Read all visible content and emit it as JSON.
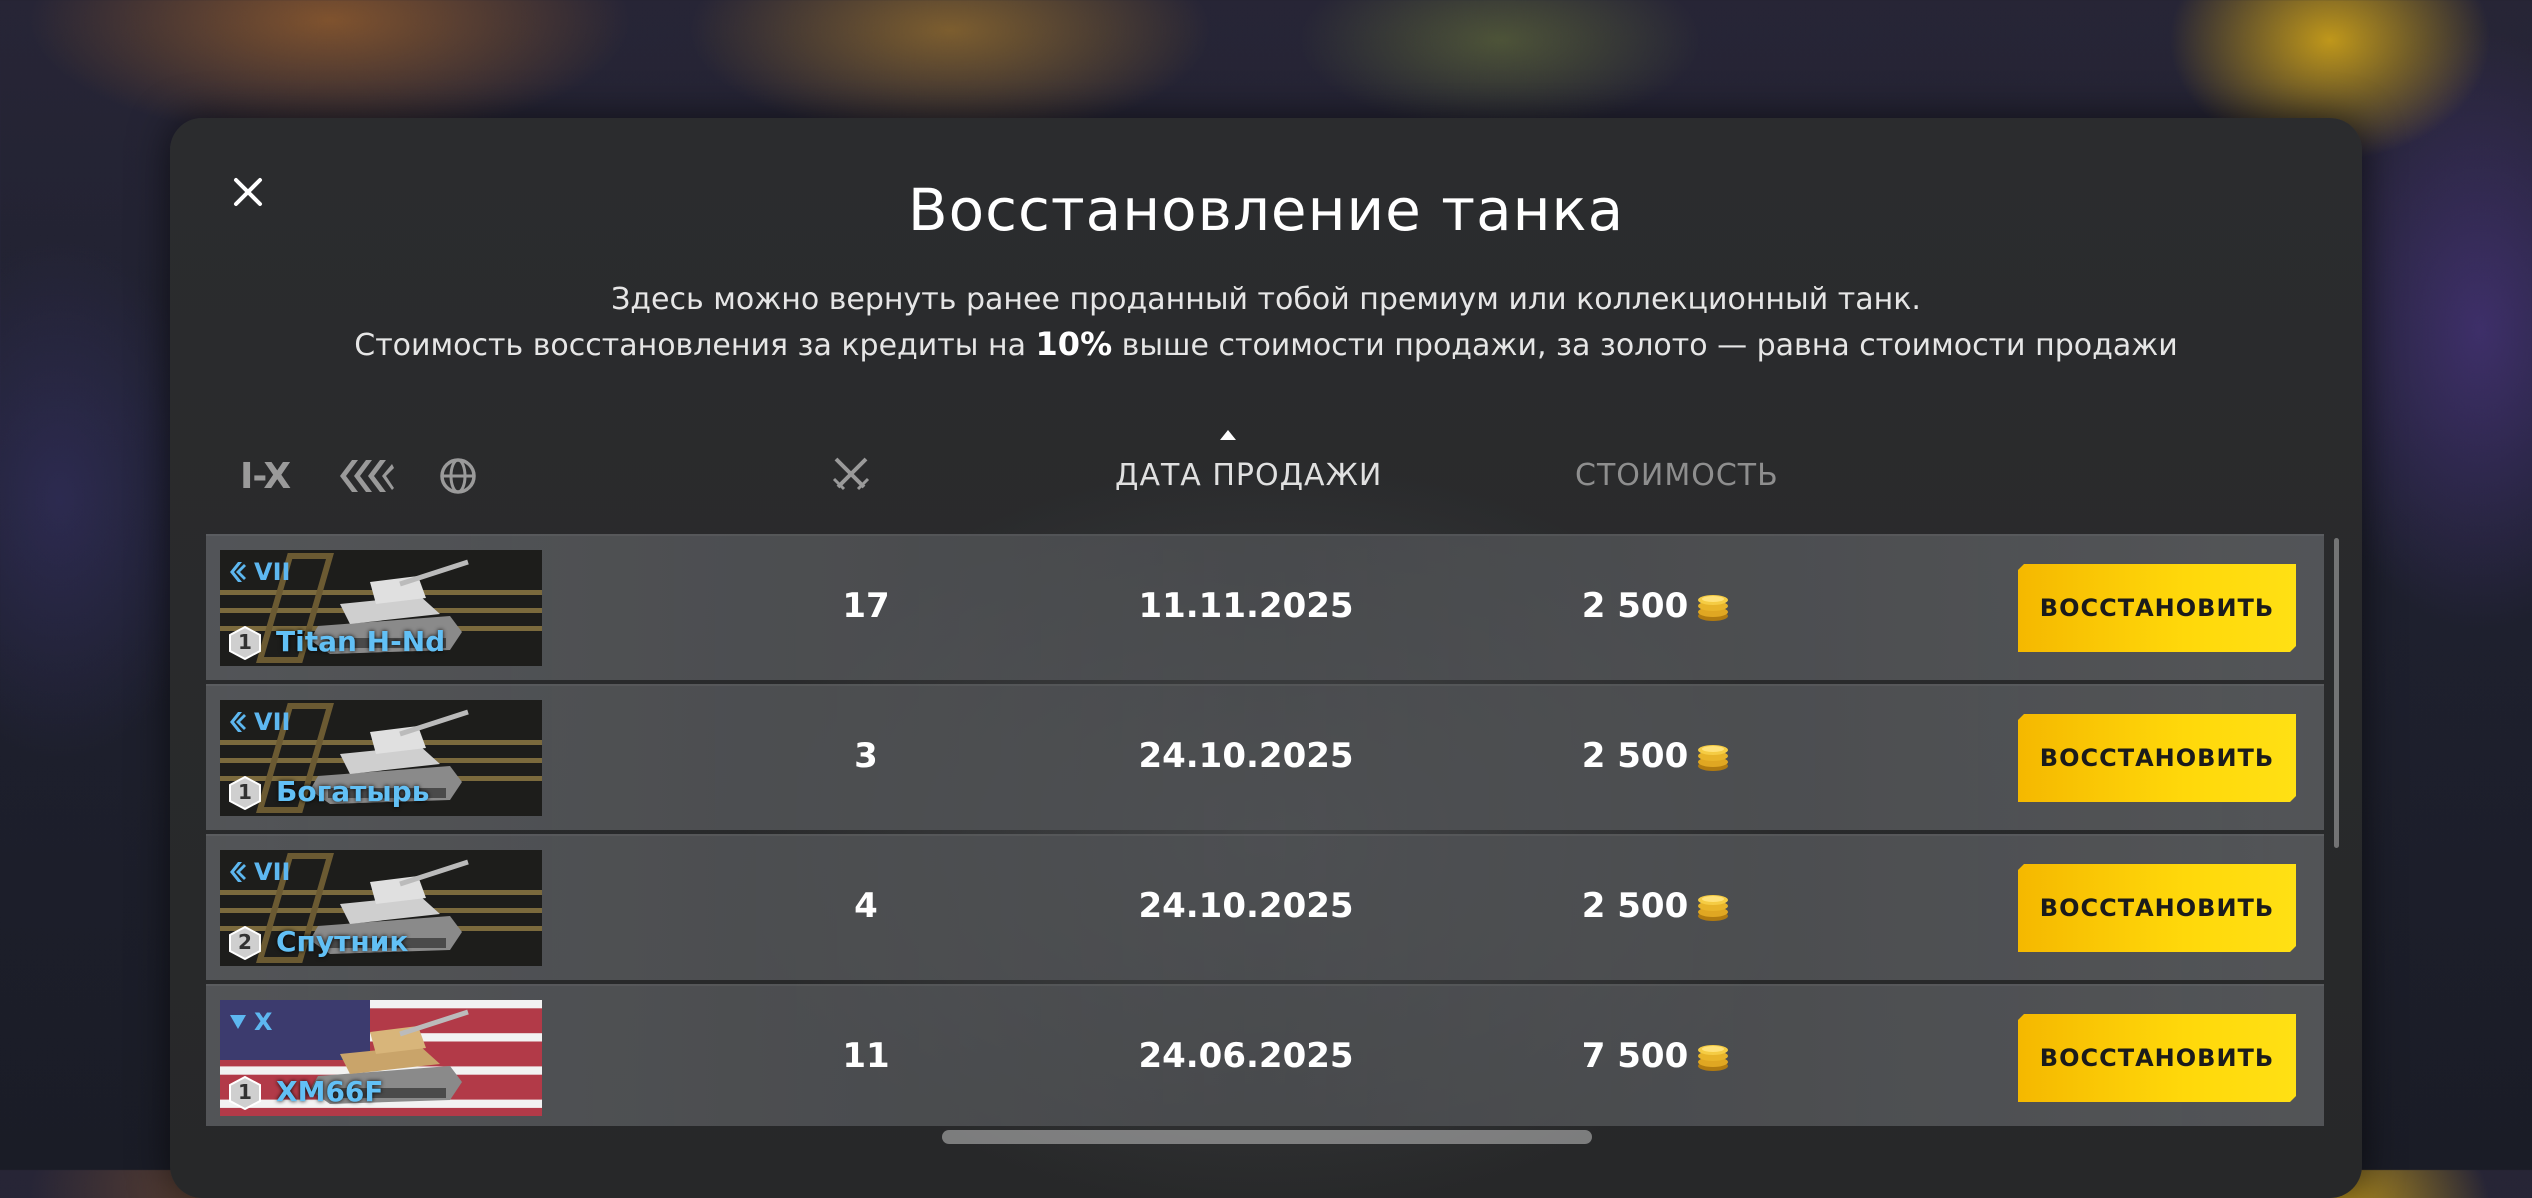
{
  "dialog": {
    "title": "Восстановление танка",
    "desc_line1": "Здесь можно вернуть ранее проданный тобой премиум или коллекционный танк.",
    "desc_line2_pre": "Стоимость восстановления за кредиты на ",
    "desc_line2_bold": "10%",
    "desc_line2_post": " выше стоимости продажи, за золото — равна стоимости продажи"
  },
  "filters": {
    "tier_label": "I-X",
    "type_icon": "vehicle-type-icon",
    "nation_icon": "globe-icon"
  },
  "columns": {
    "battles_icon": "crossed-swords-icon",
    "date": "ДАТА ПРОДАЖИ",
    "cost": "СТОИМОСТЬ"
  },
  "colors": {
    "accent_button": "#ffd80a",
    "tank_name": "#62c0f5",
    "tier_text": "#5db7f0"
  },
  "rows": [
    {
      "tier": "VII",
      "type_icon": "medium-tank-icon",
      "mastery": "1",
      "name": "Titan H-Nd",
      "battles": "17",
      "date": "11.11.2025",
      "cost": "2 500",
      "currency_icon": "gold-coins-icon",
      "button": "ВОССТАНОВИТЬ"
    },
    {
      "tier": "VII",
      "type_icon": "medium-tank-icon",
      "mastery": "1",
      "name": "Богатырь",
      "battles": "3",
      "date": "24.10.2025",
      "cost": "2 500",
      "currency_icon": "gold-coins-icon",
      "button": "ВОССТАНОВИТЬ"
    },
    {
      "tier": "VII",
      "type_icon": "medium-tank-icon",
      "mastery": "2",
      "name": "Спутник",
      "battles": "4",
      "date": "24.10.2025",
      "cost": "2 500",
      "currency_icon": "gold-coins-icon",
      "button": "ВОССТАНОВИТЬ"
    },
    {
      "tier": "X",
      "type_icon": "tank-destroyer-icon",
      "mastery": "1",
      "name": "XM66F",
      "battles": "11",
      "date": "24.06.2025",
      "cost": "7 500",
      "currency_icon": "gold-coins-icon",
      "button": "ВОССТАНОВИТЬ"
    }
  ]
}
